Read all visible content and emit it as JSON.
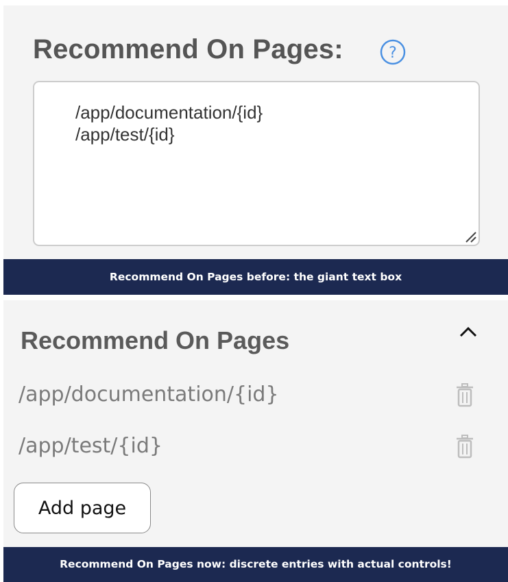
{
  "before": {
    "heading": "Recommend On Pages:",
    "textarea_value": "/app/documentation/{id}\n/app/test/{id}",
    "caption": "Recommend On Pages before: the giant text box",
    "help_icon": "question-mark-circle-icon",
    "accent_color": "#4a90e2"
  },
  "after": {
    "heading": "Recommend On Pages",
    "collapse_icon": "chevron-up-icon",
    "pages": [
      {
        "path": "/app/documentation/{id}",
        "delete_icon": "trash-icon"
      },
      {
        "path": "/app/test/{id}",
        "delete_icon": "trash-icon"
      }
    ],
    "add_button_label": "Add page",
    "caption": "Recommend On Pages now: discrete entries with actual controls!"
  },
  "caption_background": "#1c2951"
}
